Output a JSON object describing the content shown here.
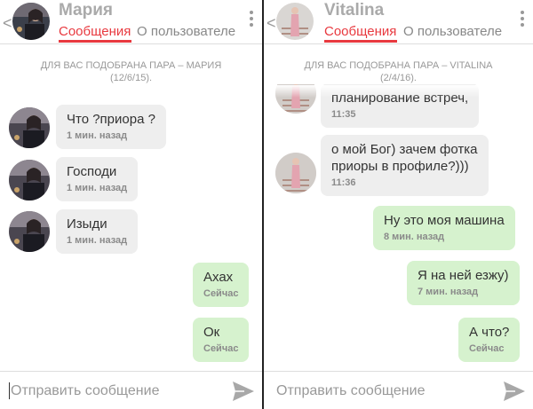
{
  "left": {
    "back_glyph": "<",
    "name": "Мария",
    "tab_messages": "Сообщения",
    "tab_profile": "О пользователе",
    "match_line1": "ДЛЯ ВАС ПОДОБРАНА ПАРА – МАРИЯ",
    "match_line2": "(12/6/15).",
    "messages": [
      {
        "dir": "in",
        "text": "Что ?приора ?",
        "time": "1 мин. назад"
      },
      {
        "dir": "in",
        "text": "Господи",
        "time": "1 мин. назад"
      },
      {
        "dir": "in",
        "text": "Изыди",
        "time": "1 мин. назад"
      },
      {
        "dir": "out",
        "text": "Ахах",
        "time": "Сейчас"
      },
      {
        "dir": "out",
        "text": "Ок",
        "time": "Сейчас"
      }
    ],
    "composer_placeholder": "Отправить сообщение"
  },
  "right": {
    "back_glyph": "<",
    "name": "Vitalina",
    "tab_messages": "Сообщения",
    "tab_profile": "О пользователе",
    "match_line1": "ДЛЯ ВАС ПОДОБРАНА ПАРА – VITALINA",
    "match_line2": "(2/4/16).",
    "messages": [
      {
        "dir": "in",
        "text": "планирование встреч,",
        "time": "11:35"
      },
      {
        "dir": "in",
        "text": "о мой Бог) зачем фотка",
        "text2": "приоры в профиле?)))",
        "time": "11:36"
      },
      {
        "dir": "out",
        "text": "Ну это моя машина",
        "time": "8 мин. назад"
      },
      {
        "dir": "out",
        "text": "Я на ней езжу)",
        "time": "7 мин. назад"
      },
      {
        "dir": "out",
        "text": "А что?",
        "time": "Сейчас"
      }
    ],
    "composer_placeholder": "Отправить сообщение"
  },
  "colors": {
    "accent": "#e8393f",
    "incoming_bubble": "#eeeeee",
    "outgoing_bubble": "#d6f2ce",
    "muted_text": "#999999"
  },
  "icons": {
    "back": "chevron-left-icon",
    "menu": "more-vertical-icon",
    "send": "send-icon"
  }
}
